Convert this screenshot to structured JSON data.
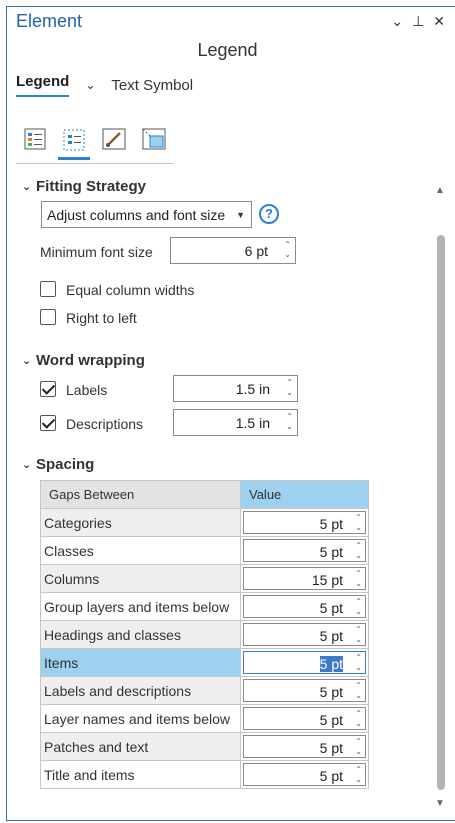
{
  "pane": {
    "title": "Element",
    "window_buttons": [
      "⌄",
      "⊥",
      "✕"
    ]
  },
  "subtitle": "Legend",
  "tabs": {
    "active": "Legend",
    "other": "Text Symbol"
  },
  "tools": [
    {
      "icon": "legend-properties-icon"
    },
    {
      "icon": "arrangement-icon",
      "selected": true
    },
    {
      "icon": "display-brush-icon"
    },
    {
      "icon": "placement-icon"
    }
  ],
  "fitting": {
    "section_label": "Fitting Strategy",
    "strategy_value": "Adjust columns and font size",
    "min_font_label": "Minimum font size",
    "min_font_value": "6 pt",
    "equal_columns_label": "Equal column widths",
    "right_to_left_label": "Right to left"
  },
  "wrapping": {
    "section_label": "Word wrapping",
    "labels_label": "Labels",
    "labels_value": "1.5 in",
    "descriptions_label": "Descriptions",
    "descriptions_value": "1.5 in"
  },
  "spacing": {
    "section_label": "Spacing",
    "headers": [
      "Gaps Between",
      "Value"
    ],
    "rows": [
      {
        "name": "Categories",
        "value": "5 pt"
      },
      {
        "name": "Classes",
        "value": "5 pt"
      },
      {
        "name": "Columns",
        "value": "15 pt"
      },
      {
        "name": "Group layers and items below",
        "value": "5 pt"
      },
      {
        "name": "Headings and classes",
        "value": "5 pt"
      },
      {
        "name": "Items",
        "value": "5 pt",
        "selected": true
      },
      {
        "name": "Labels and descriptions",
        "value": "5 pt"
      },
      {
        "name": "Layer names and items below",
        "value": "5 pt"
      },
      {
        "name": "Patches and text",
        "value": "5 pt"
      },
      {
        "name": "Title and items",
        "value": "5 pt"
      }
    ]
  },
  "colors": {
    "accent": "#2a7fd4",
    "title": "#2262a8",
    "selected_row": "#9ed0f0"
  }
}
